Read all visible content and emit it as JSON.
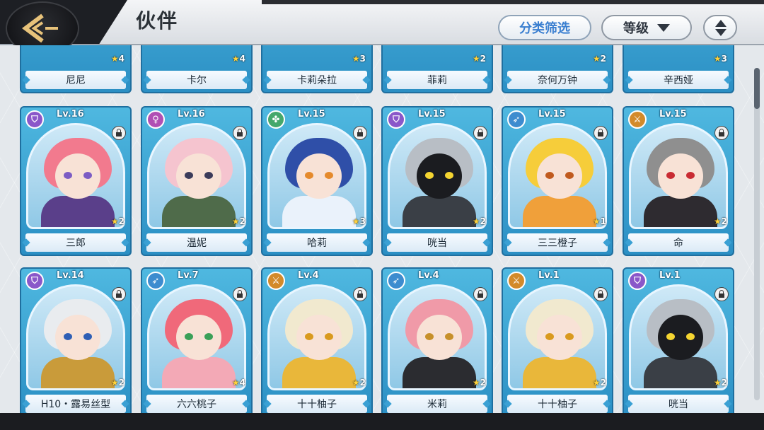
{
  "header": {
    "title": "伙伴",
    "filter_label": "分类筛选",
    "sort_label": "等级"
  },
  "partial_row": [
    {
      "name": "尼尼",
      "stars": "4"
    },
    {
      "name": "卡尔",
      "stars": "4"
    },
    {
      "name": "卡莉朵拉",
      "stars": "3"
    },
    {
      "name": "菲莉",
      "stars": "2"
    },
    {
      "name": "奈何万钟",
      "stars": "2"
    },
    {
      "name": "辛西娅",
      "stars": "3"
    }
  ],
  "cards": [
    {
      "name": "三郎",
      "level": "Lv.16",
      "stars": "2",
      "element": "shield",
      "element_color": "#8a57c9",
      "hair": "#f27a8e",
      "body": "#5a3f8a",
      "eye": "#7c5cc4"
    },
    {
      "name": "温妮",
      "level": "Lv.16",
      "stars": "2",
      "element": "female",
      "element_color": "#b04fb4",
      "hair": "#f5c4cf",
      "body": "#4f6b4a",
      "eye": "#3b3b5a"
    },
    {
      "name": "哈莉",
      "level": "Lv.15",
      "stars": "3",
      "element": "clover",
      "element_color": "#45a86b",
      "hair": "#2f4fa8",
      "body": "#eaf2fb",
      "eye": "#e58a2c"
    },
    {
      "name": "咣当",
      "level": "Lv.15",
      "stars": "2",
      "element": "shield",
      "element_color": "#8a57c9",
      "hair": "#b8bec5",
      "body": "#3a3f46",
      "eye": "#f5d531"
    },
    {
      "name": "三三橙子",
      "level": "Lv.15",
      "stars": "1",
      "element": "bow",
      "element_color": "#3d8ccf",
      "hair": "#f6cd3a",
      "body": "#f0a03a",
      "eye": "#c05a1e"
    },
    {
      "name": "命",
      "level": "Lv.15",
      "stars": "2",
      "element": "sword",
      "element_color": "#d38a2a",
      "hair": "#8f8f8f",
      "body": "#2e2b30",
      "eye": "#c92b33"
    },
    {
      "name": "H10・露易丝型",
      "level": "Lv.14",
      "stars": "2",
      "element": "shield",
      "element_color": "#8a57c9",
      "hair": "#e9ecef",
      "body": "#c99b3a",
      "eye": "#2f5fb5"
    },
    {
      "name": "六六桃子",
      "level": "Lv.7",
      "stars": "4",
      "element": "bow",
      "element_color": "#3d8ccf",
      "hair": "#f0697a",
      "body": "#f3a9b6",
      "eye": "#3aa058"
    },
    {
      "name": "十十柚子",
      "level": "Lv.4",
      "stars": "2",
      "element": "sword",
      "element_color": "#d38a2a",
      "hair": "#f1e9cf",
      "body": "#e9b73a",
      "eye": "#d99a1e"
    },
    {
      "name": "米莉",
      "level": "Lv.4",
      "stars": "2",
      "element": "bow",
      "element_color": "#3d8ccf",
      "hair": "#f09aa8",
      "body": "#2b2c30",
      "eye": "#c7902a"
    },
    {
      "name": "十十柚子",
      "level": "Lv.1",
      "stars": "2",
      "element": "sword",
      "element_color": "#d38a2a",
      "hair": "#f1e9cf",
      "body": "#e9b73a",
      "eye": "#d99a1e"
    },
    {
      "name": "咣当",
      "level": "Lv.1",
      "stars": "2",
      "element": "shield",
      "element_color": "#8a57c9",
      "hair": "#b8bec5",
      "body": "#3a3f46",
      "eye": "#f5d531"
    }
  ]
}
